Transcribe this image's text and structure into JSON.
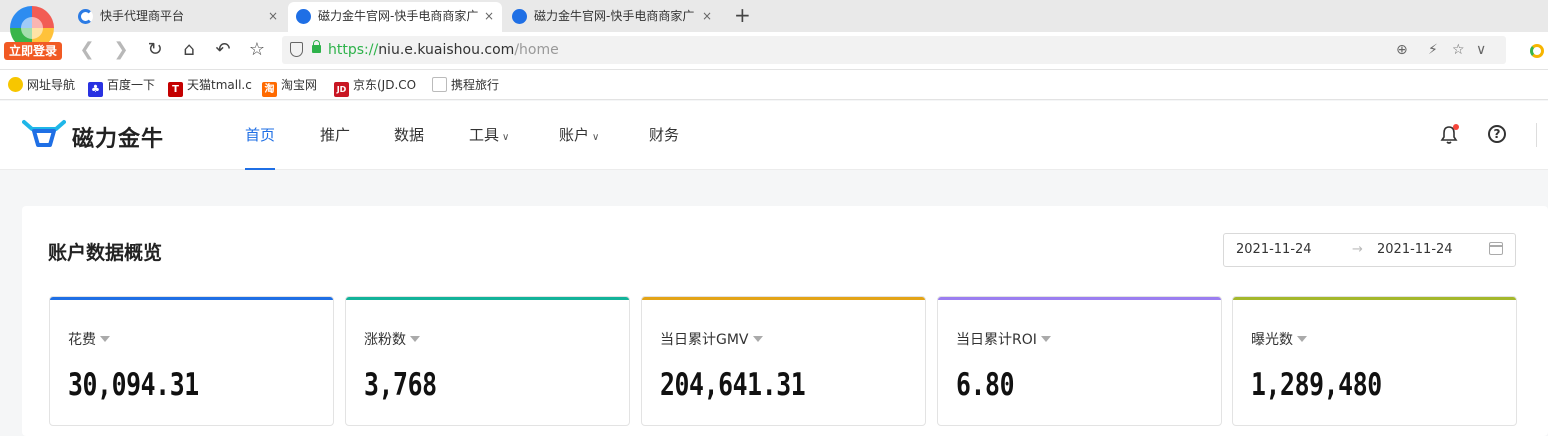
{
  "browser": {
    "login_badge": "立即登录",
    "tabs": [
      {
        "title": "快手代理商平台",
        "close": "×"
      },
      {
        "title": "磁力金牛官网-快手电商商家广",
        "close": "×"
      },
      {
        "title": "磁力金牛官网-快手电商商家广",
        "close": "×"
      }
    ],
    "new_tab": "+",
    "address": {
      "scheme": "https://",
      "domain": "niu.e.kuaishou.com",
      "path": "/home"
    },
    "bookmarks": [
      {
        "label": "网址导航",
        "icon": "navigation-icon",
        "color": "#f7c600"
      },
      {
        "label": "百度一下",
        "icon": "baidu-icon",
        "color": "#2932e1"
      },
      {
        "label": "天猫tmall.c",
        "icon": "tmall-icon",
        "color": "#c40000",
        "glyph": "T"
      },
      {
        "label": "淘宝网",
        "icon": "taobao-icon",
        "color": "#ff6a00",
        "glyph": "淘"
      },
      {
        "label": "京东(JD.CO",
        "icon": "jd-icon",
        "color": "#c81623",
        "glyph": "JD"
      },
      {
        "label": "携程旅行",
        "icon": "page-icon",
        "color": "#cccccc"
      }
    ]
  },
  "app": {
    "brand": "磁力金牛",
    "nav": [
      {
        "label": "首页",
        "active": true
      },
      {
        "label": "推广"
      },
      {
        "label": "数据"
      },
      {
        "label": "工具",
        "dropdown": true
      },
      {
        "label": "账户",
        "dropdown": true
      },
      {
        "label": "财务"
      }
    ],
    "help": "?"
  },
  "overview": {
    "title": "账户数据概览",
    "date_start": "2021-11-24",
    "date_sep": "→",
    "date_end": "2021-11-24",
    "metrics": [
      {
        "label": "花费",
        "value": "30,094.31",
        "color": "#1f6fe5"
      },
      {
        "label": "涨粉数",
        "value": "3,768",
        "color": "#13b39a"
      },
      {
        "label": "当日累计GMV",
        "value": "204,641.31",
        "color": "#e3a417"
      },
      {
        "label": "当日累计ROI",
        "value": "6.80",
        "color": "#9b7ef0"
      },
      {
        "label": "曝光数",
        "value": "1,289,480",
        "color": "#a4b82c"
      }
    ]
  }
}
